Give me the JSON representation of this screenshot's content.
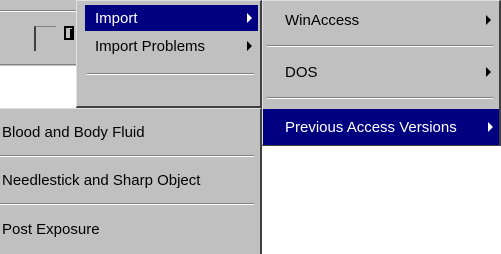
{
  "colors": {
    "menu_face": "#c0c0c0",
    "highlight": "#000080",
    "highlight_text": "#ffffff"
  },
  "import_menu": {
    "items": [
      {
        "label": "Import",
        "has_submenu": true
      },
      {
        "label": "Import Problems",
        "has_submenu": true
      },
      {
        "label": "",
        "has_submenu": true
      }
    ]
  },
  "import_submenu": {
    "items": [
      {
        "label": "WinAccess",
        "has_submenu": true
      },
      {
        "label": "DOS",
        "has_submenu": true
      },
      {
        "label": "Previous Access Versions",
        "has_submenu": true,
        "highlighted": true
      }
    ]
  },
  "problem_menu": {
    "items": [
      {
        "label": "Blood and Body Fluid"
      },
      {
        "label": "Needlestick and Sharp Object"
      },
      {
        "label": "Post Exposure"
      }
    ]
  }
}
